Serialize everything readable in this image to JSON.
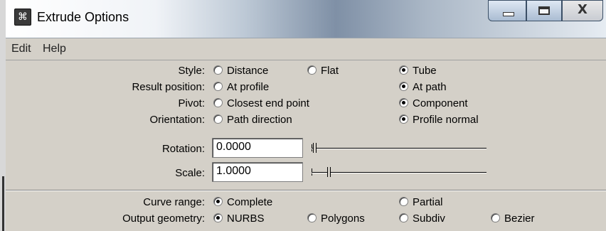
{
  "window": {
    "title": "Extrude Options"
  },
  "titlebar_buttons": {
    "close": "X"
  },
  "menu": [
    "Edit",
    "Help"
  ],
  "options": {
    "style": {
      "label": "Style:",
      "choices": [
        "Distance",
        "Flat",
        "Tube"
      ],
      "selected": "Tube"
    },
    "result_position": {
      "label": "Result position:",
      "choices": [
        "At profile",
        "At path"
      ],
      "selected": "At path"
    },
    "pivot": {
      "label": "Pivot:",
      "choices": [
        "Closest end point",
        "Component"
      ],
      "selected": "Component"
    },
    "orientation": {
      "label": "Orientation:",
      "choices": [
        "Path direction",
        "Profile normal"
      ],
      "selected": "Profile normal"
    },
    "rotation": {
      "label": "Rotation:",
      "value": "0.0000"
    },
    "scale": {
      "label": "Scale:",
      "value": "1.0000"
    },
    "curve_range": {
      "label": "Curve range:",
      "choices": [
        "Complete",
        "Partial"
      ],
      "selected": "Complete"
    },
    "output_geometry": {
      "label": "Output geometry:",
      "choices": [
        "NURBS",
        "Polygons",
        "Subdiv",
        "Bezier"
      ],
      "selected": "NURBS"
    }
  }
}
